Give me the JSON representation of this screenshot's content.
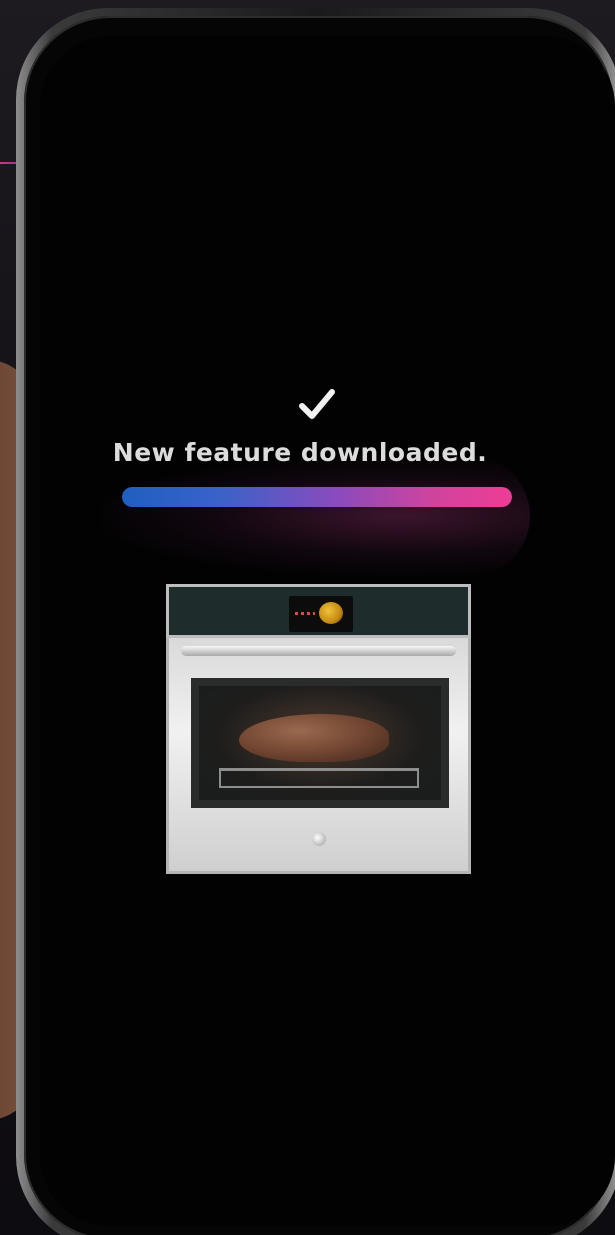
{
  "status": {
    "message": "New feature downloaded.",
    "progress_percent": 100
  },
  "colors": {
    "progress_start": "#1f5fc0",
    "progress_end": "#ee3d95",
    "text": "#dcdcdc",
    "screen_background": "#020202"
  },
  "icons": {
    "status": "checkmark-icon"
  },
  "product": {
    "type": "wall-oven"
  }
}
